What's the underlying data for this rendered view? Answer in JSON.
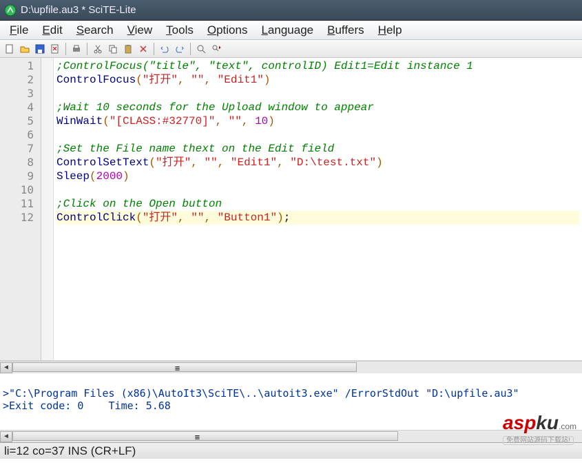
{
  "window": {
    "title": "D:\\upfile.au3 * SciTE-Lite"
  },
  "menu": {
    "file": "File",
    "edit": "Edit",
    "search": "Search",
    "view": "View",
    "tools": "Tools",
    "options": "Options",
    "language": "Language",
    "buffers": "Buffers",
    "help": "Help"
  },
  "toolbar_icons": {
    "new": "new-file-icon",
    "open": "open-folder-icon",
    "save": "save-icon",
    "close": "close-file-icon",
    "print": "print-icon",
    "cut": "cut-icon",
    "copy": "copy-icon",
    "paste": "paste-icon",
    "delete": "delete-icon",
    "undo": "undo-icon",
    "redo": "redo-icon",
    "find": "find-icon",
    "replace": "replace-icon"
  },
  "code": {
    "line_count": 12,
    "highlighted_line": 12,
    "lines": [
      {
        "type": "comment",
        "text": ";ControlFocus(\"title\", \"text\", controlID) Edit1=Edit instance 1"
      },
      {
        "type": "call",
        "fn": "ControlFocus",
        "args": [
          "\"打开\"",
          "\"\"",
          "\"Edit1\""
        ]
      },
      {
        "type": "blank"
      },
      {
        "type": "comment",
        "text": ";Wait 10 seconds for the Upload window to appear"
      },
      {
        "type": "call",
        "fn": "WinWait",
        "args": [
          "\"[CLASS:#32770]\"",
          "\"\"",
          "10"
        ]
      },
      {
        "type": "blank"
      },
      {
        "type": "comment",
        "text": ";Set the File name thext on the Edit field"
      },
      {
        "type": "call",
        "fn": "ControlSetText",
        "args": [
          "\"打开\"",
          "\"\"",
          "\"Edit1\"",
          "\"D:\\test.txt\""
        ]
      },
      {
        "type": "call",
        "fn": "Sleep",
        "args": [
          "2000"
        ]
      },
      {
        "type": "blank"
      },
      {
        "type": "comment",
        "text": ";Click on the Open button"
      },
      {
        "type": "call",
        "fn": "ControlClick",
        "args": [
          "\"打开\"",
          "\"\"",
          "\"Button1\""
        ],
        "tail": ";"
      }
    ]
  },
  "output": {
    "line1": ">\"C:\\Program Files (x86)\\AutoIt3\\SciTE\\..\\autoit3.exe\" /ErrorStdOut \"D:\\upfile.au3\"",
    "line2": ">Exit code: 0    Time: 5.68"
  },
  "status": {
    "text": "li=12 co=37 INS (CR+LF)"
  },
  "watermark": {
    "brand1": "asp",
    "brand2": "ku",
    "ext": ".com",
    "tagline": "免费网站源码下载站!"
  }
}
